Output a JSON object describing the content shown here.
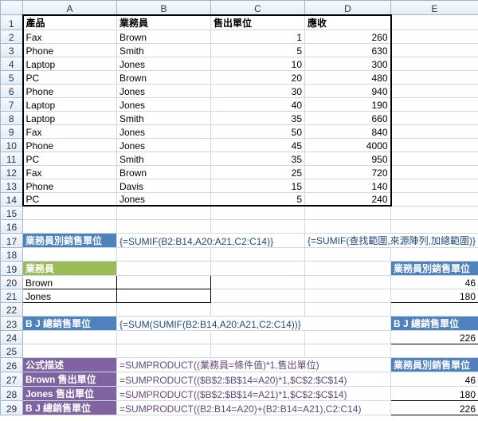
{
  "cols": [
    "",
    "A",
    "B",
    "C",
    "D",
    "E"
  ],
  "headers": {
    "a": "產品",
    "b": "業務員",
    "c": "售出單位",
    "d": "應收"
  },
  "rows": [
    {
      "a": "Fax",
      "b": "Brown",
      "c": 1,
      "d": 260
    },
    {
      "a": "Phone",
      "b": "Smith",
      "c": 5,
      "d": 630
    },
    {
      "a": "Laptop",
      "b": "Jones",
      "c": 10,
      "d": 300
    },
    {
      "a": "PC",
      "b": "Brown",
      "c": 20,
      "d": 480
    },
    {
      "a": "Phone",
      "b": "Jones",
      "c": 30,
      "d": 940
    },
    {
      "a": "Laptop",
      "b": "Jones",
      "c": 40,
      "d": 190
    },
    {
      "a": "Laptop",
      "b": "Smith",
      "c": 35,
      "d": 660
    },
    {
      "a": "Fax",
      "b": "Jones",
      "c": 50,
      "d": 840
    },
    {
      "a": "Phone",
      "b": "Jones",
      "c": 45,
      "d": 4000
    },
    {
      "a": "PC",
      "b": "Smith",
      "c": 35,
      "d": 950
    },
    {
      "a": "Fax",
      "b": "Brown",
      "c": 25,
      "d": 720
    },
    {
      "a": "Phone",
      "b": "Davis",
      "c": 15,
      "d": 140
    },
    {
      "a": "PC",
      "b": "Jones",
      "c": 5,
      "d": 240
    }
  ],
  "sec17": {
    "label": "業務員別銷售單位",
    "formula_b": "{=SUMIF(B2:B14,A20:A21,C2:C14)}",
    "formula_d": "{=SUMIF(查找範圍,來源陣列,加總範圍)}"
  },
  "sec19": {
    "a": "業務員",
    "e": "業務員別銷售單位"
  },
  "names": {
    "r20": "Brown",
    "r21": "Jones"
  },
  "vals19": {
    "r20": 46,
    "r21": 180
  },
  "sec23": {
    "a": "B J 總銷售單位",
    "formula_b": "{=SUM(SUMIF(B2:B14,A20:A21,C2:C14))}",
    "e": "B J 總銷售單位",
    "val": 226
  },
  "sec26": {
    "a": "公式描述",
    "b": "=SUMPRODUCT((業務員=條件值)*1,售出單位)",
    "e": "業務員別銷售單位"
  },
  "sec27": {
    "a": "Brown 售出單位",
    "b": "=SUMPRODUCT(($B$2:$B$14=A20)*1,$C$2:$C$14)",
    "e": 46
  },
  "sec28": {
    "a": "Jones 售出單位",
    "b": "=SUMPRODUCT(($B$2:$B$14=A21)*1,$C$2:$C$14)",
    "e": 180
  },
  "sec29": {
    "a": "B J 總銷售單位",
    "b": "=SUMPRODUCT((B2:B14=A20)+(B2:B14=A21),C2:C14)",
    "e": 226
  }
}
